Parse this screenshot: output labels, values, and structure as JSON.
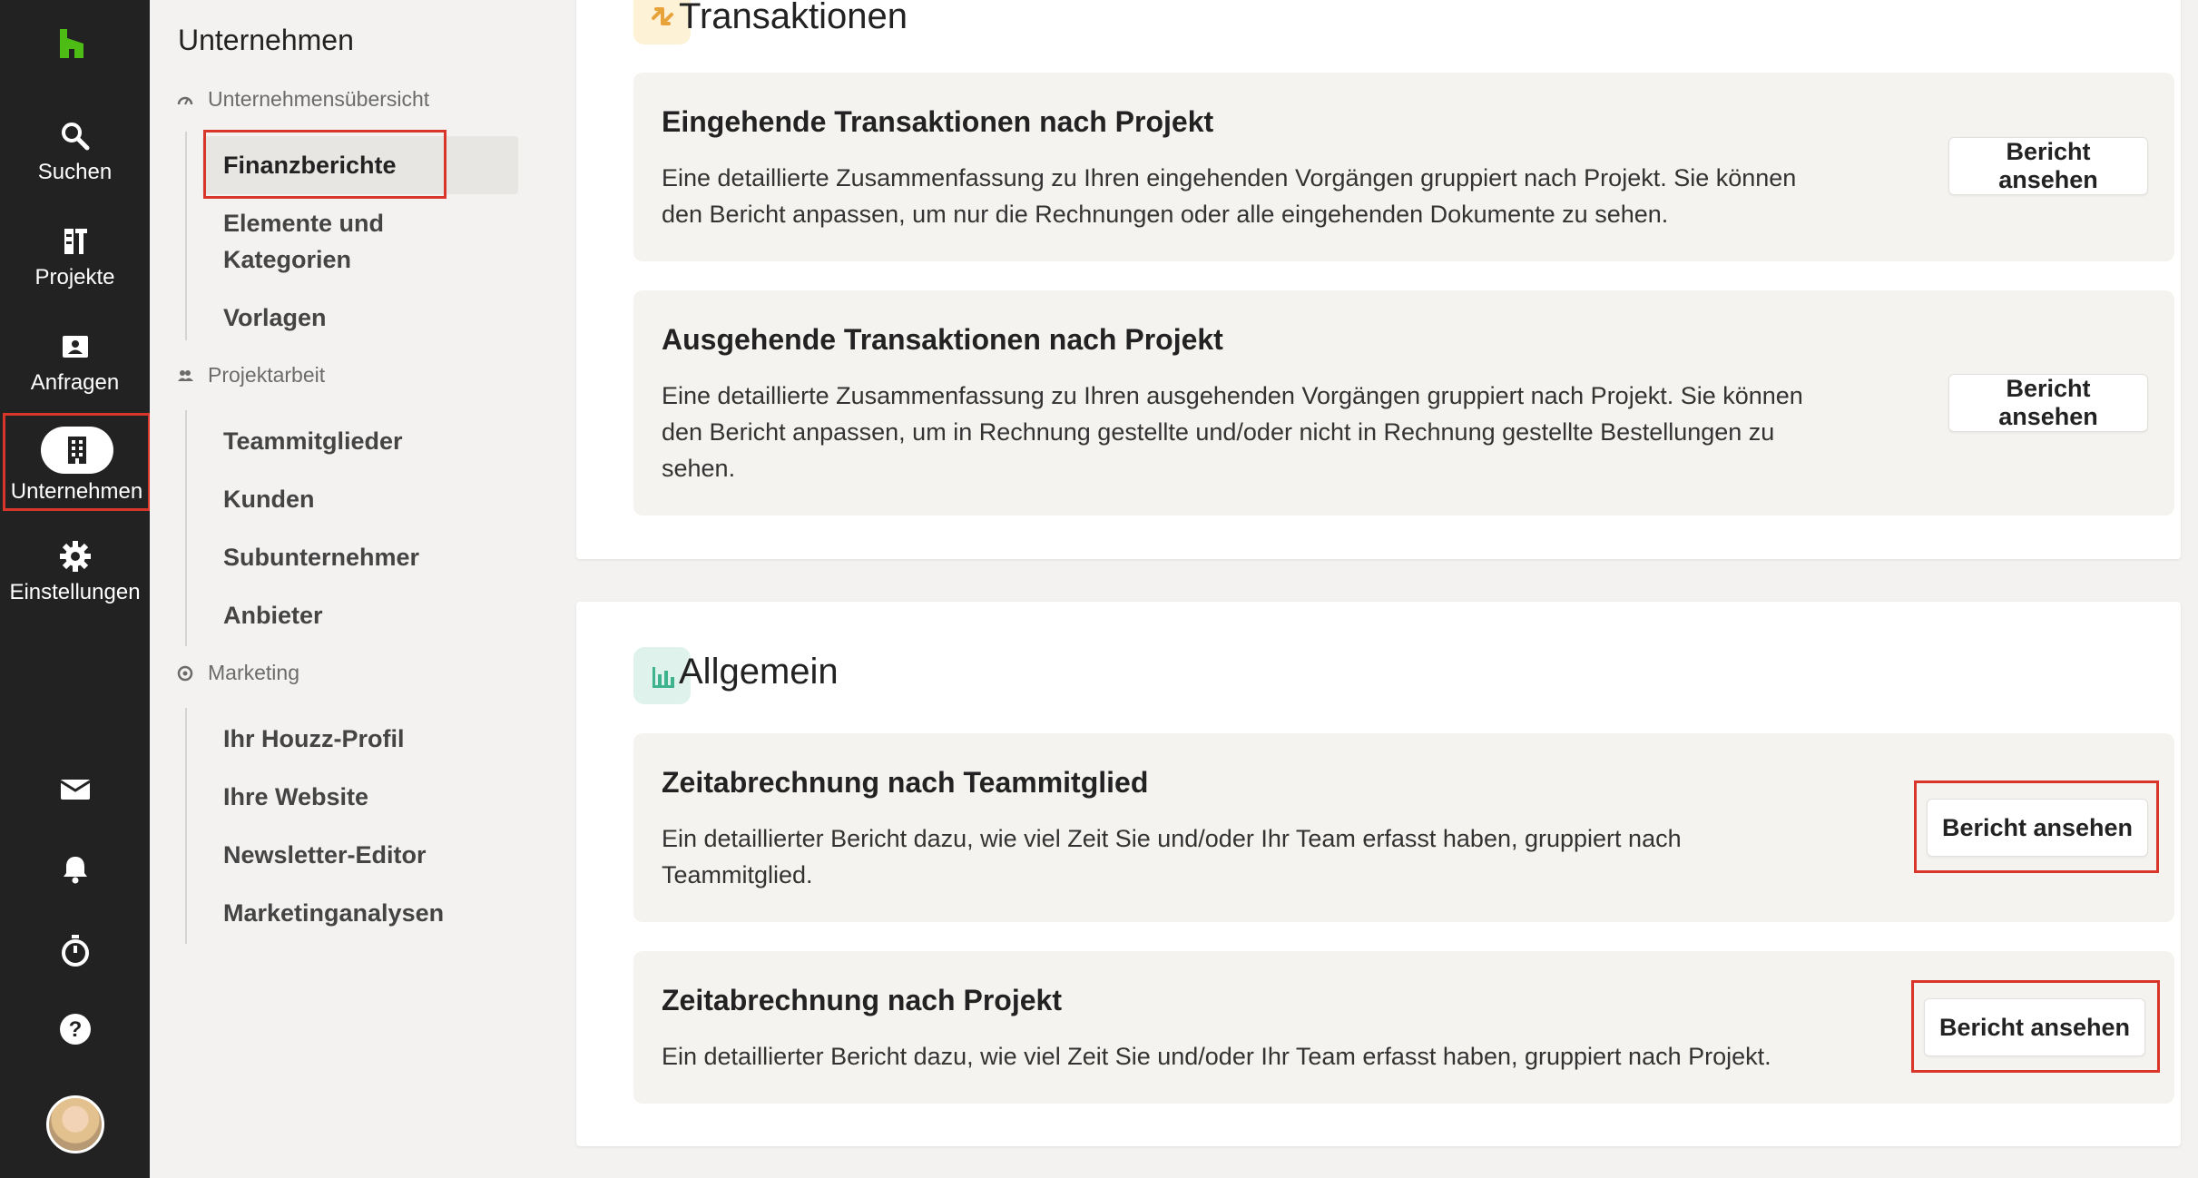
{
  "rail": {
    "items": [
      {
        "label": "Suchen",
        "icon": "search-icon"
      },
      {
        "label": "Projekte",
        "icon": "projects-icon"
      },
      {
        "label": "Anfragen",
        "icon": "inquiries-icon"
      },
      {
        "label": "Unternehmen",
        "icon": "building-icon"
      },
      {
        "label": "Einstellungen",
        "icon": "gear-icon"
      }
    ],
    "bottom_icons": [
      "mail-icon",
      "bell-icon",
      "timer-icon",
      "help-icon"
    ]
  },
  "subnav": {
    "title": "Unternehmen",
    "groups": [
      {
        "label": "Unternehmensübersicht",
        "icon": "dashboard-icon",
        "items": [
          "Finanzberichte",
          "Elemente und Kategorien",
          "Vorlagen"
        ]
      },
      {
        "label": "Projektarbeit",
        "icon": "people-icon",
        "items": [
          "Teammitglieder",
          "Kunden",
          "Subunternehmer",
          "Anbieter"
        ]
      },
      {
        "label": "Marketing",
        "icon": "marketing-icon",
        "items": [
          "Ihr Houzz-Profil",
          "Ihre Website",
          "Newsletter-Editor",
          "Marketinganalysen"
        ]
      }
    ],
    "active_item": "Finanzberichte"
  },
  "main": {
    "sections": [
      {
        "title": "Transaktionen",
        "icon": "transactions-icon",
        "cards": [
          {
            "title": "Eingehende Transaktionen nach Projekt",
            "description_lines": [
              "Eine detaillierte Zusammenfassung zu Ihren eingehenden Vorgängen gruppiert nach Projekt. Sie können",
              "den Bericht anpassen, um nur die Rechnungen oder alle eingehenden Dokumente zu sehen."
            ],
            "button": "Bericht ansehen"
          },
          {
            "title": "Ausgehende Transaktionen nach Projekt",
            "description_lines": [
              "Eine detaillierte Zusammenfassung zu Ihren ausgehenden Vorgängen gruppiert nach Projekt. Sie können",
              "den Bericht anpassen, um in Rechnung gestellte und/oder nicht in Rechnung gestellte Bestellungen zu",
              "sehen."
            ],
            "button": "Bericht ansehen"
          }
        ]
      },
      {
        "title": "Allgemein",
        "icon": "bar-chart-icon",
        "cards": [
          {
            "title": "Zeitabrechnung nach Teammitglied",
            "description_lines": [
              "Ein detaillierter Bericht dazu, wie viel Zeit Sie und/oder Ihr Team erfasst haben, gruppiert nach",
              "Teammitglied."
            ],
            "button": "Bericht ansehen"
          },
          {
            "title": "Zeitabrechnung nach Projekt",
            "description_lines": [
              "Ein detaillierter Bericht dazu, wie viel Zeit Sie und/oder Ihr Team erfasst haben, gruppiert nach Projekt."
            ],
            "button": "Bericht ansehen"
          }
        ]
      }
    ]
  },
  "colors": {
    "rail_bg": "#222222",
    "brand_green": "#4dbc15",
    "highlight": "#d9362b",
    "card_bg": "#f5f3ef"
  }
}
